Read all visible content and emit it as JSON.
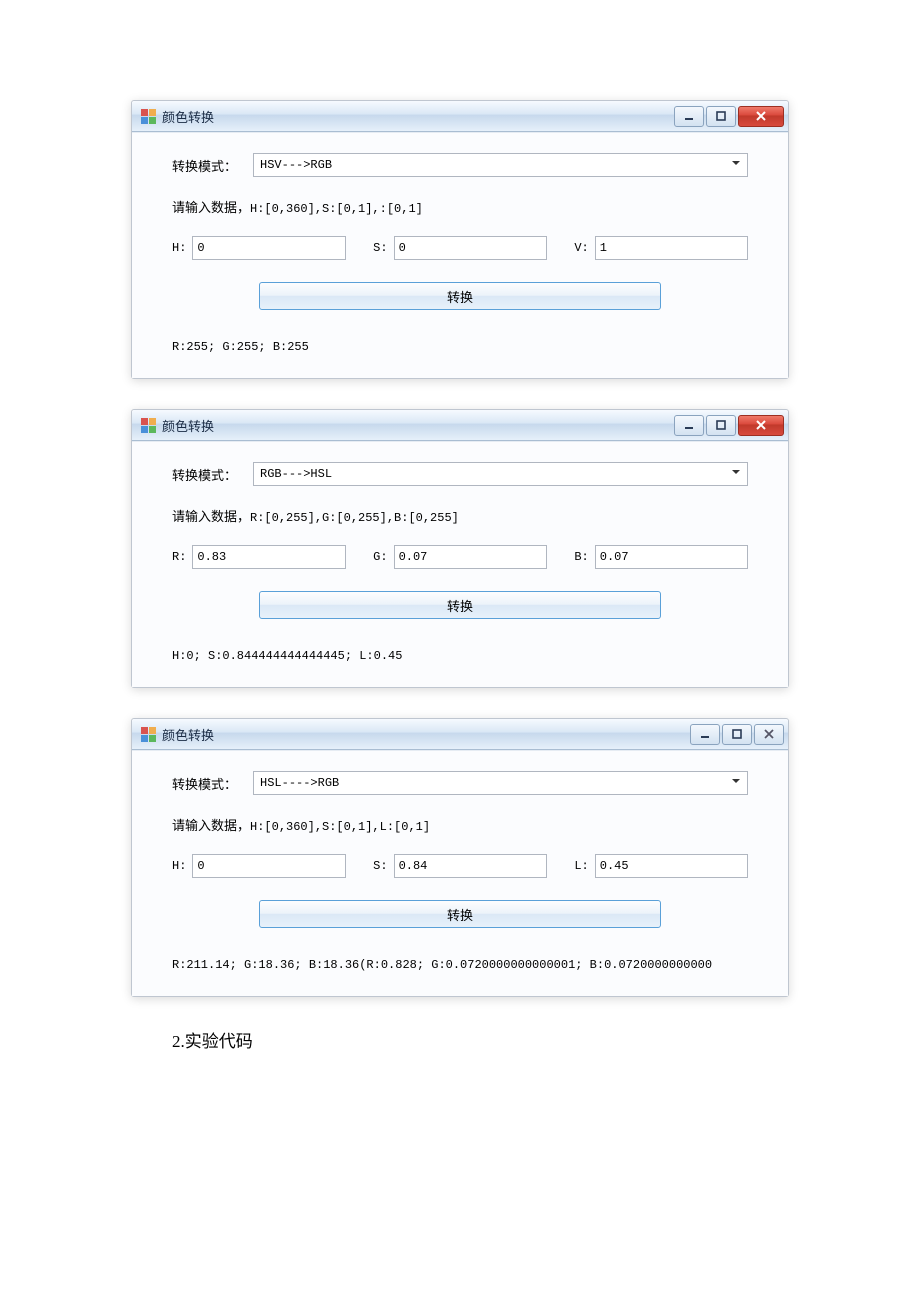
{
  "footnote": "2.实验代码",
  "common": {
    "mode_label": "转换模式：",
    "convert_label": "转换"
  },
  "windows": [
    {
      "title": "颜色转换",
      "mode_value": "HSV--->RGB",
      "hint_prefix": "请输入数据，",
      "hint_ranges": "H:[0,360],S:[0,1],:[0,1]",
      "labels": [
        "H:",
        "S:",
        "V:"
      ],
      "values": [
        "0",
        "0",
        "1"
      ],
      "result": "R:255;   G:255;   B:255",
      "close_style": "red"
    },
    {
      "title": "颜色转换",
      "mode_value": "RGB--->HSL",
      "hint_prefix": "请输入数据，",
      "hint_ranges": "R:[0,255],G:[0,255],B:[0,255]",
      "labels": [
        "R:",
        "G:",
        "B:"
      ],
      "values": [
        "0.83",
        "0.07",
        "0.07"
      ],
      "result": "H:0;   S:0.844444444444445;   L:0.45",
      "close_style": "red"
    },
    {
      "title": "颜色转换",
      "mode_value": "HSL---->RGB",
      "hint_prefix": "请输入数据，",
      "hint_ranges": "H:[0,360],S:[0,1],L:[0,1]",
      "labels": [
        "H:",
        "S:",
        "L:"
      ],
      "values": [
        "0",
        "0.84",
        "0.45"
      ],
      "result": "R:211.14;   G:18.36;   B:18.36(R:0.828;   G:0.0720000000000001;   B:0.0720000000000",
      "close_style": "gray"
    }
  ]
}
